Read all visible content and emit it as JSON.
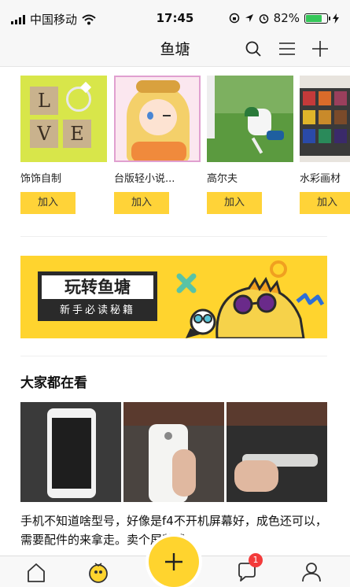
{
  "status_bar": {
    "carrier": "中国移动",
    "time": "17:45",
    "battery_percent": "82%",
    "battery_level": 0.82
  },
  "nav": {
    "title": "鱼塘",
    "icons": [
      "search-icon",
      "menu-icon",
      "add-icon"
    ]
  },
  "groups": [
    {
      "name": "饰饰自制",
      "join_label": "加入"
    },
    {
      "name": "台版轻小说...",
      "join_label": "加入"
    },
    {
      "name": "高尔夫",
      "join_label": "加入"
    },
    {
      "name": "水彩画材",
      "join_label": "加入"
    }
  ],
  "banner": {
    "title": "玩转鱼塘",
    "subtitle": "新手必读秘籍"
  },
  "feed": {
    "section_title": "大家都在看",
    "post_text": "手机不知道啥型号，好像是f4不开机屏幕好，成色还可以，需要配件的来拿走。卖个屏幕钱"
  },
  "tab_bar": {
    "icons": [
      "home-icon",
      "fish-pond-icon",
      "publish-icon",
      "message-icon",
      "profile-icon"
    ],
    "message_badge": "1"
  },
  "colors": {
    "accent": "#ffd42e",
    "badge": "#f33b3b"
  }
}
